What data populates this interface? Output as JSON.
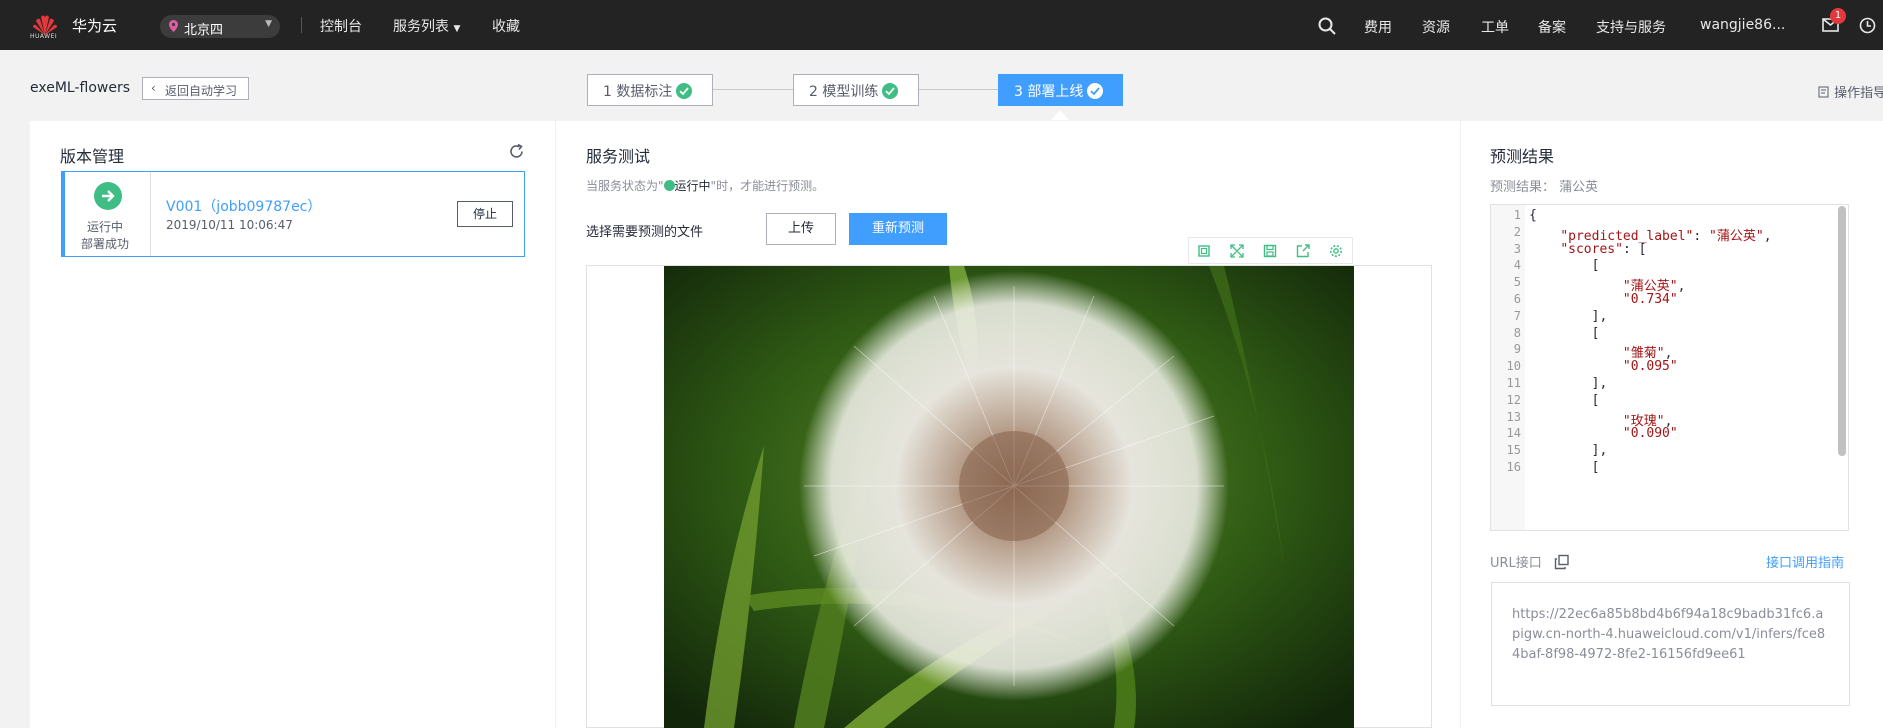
{
  "topbar": {
    "logo_text": "HUAWEI",
    "brand": "华为云",
    "region": "北京四",
    "nav": [
      "控制台",
      "服务列表",
      "收藏"
    ],
    "right_nav": [
      "费用",
      "资源",
      "工单",
      "备案",
      "支持与服务"
    ],
    "user": "wangjie86...",
    "message_count": "1"
  },
  "header": {
    "project": "exeML-flowers",
    "back_label": "返回自动学习",
    "steps": [
      {
        "label": "1 数据标注",
        "done": true
      },
      {
        "label": "2 模型训练",
        "done": true
      },
      {
        "label": "3 部署上线",
        "done": true,
        "active": true
      }
    ],
    "guide": "操作指导"
  },
  "version_panel": {
    "title": "版本管理",
    "card": {
      "status_line1": "运行中",
      "status_line2": "部署成功",
      "name": "V001（jobb09787ec）",
      "date": "2019/10/11 10:06:47",
      "stop_label": "停止"
    }
  },
  "service_panel": {
    "title": "服务测试",
    "hint_prefix": "当服务状态为\"",
    "hint_status": "运行中",
    "hint_suffix": "\"时，才能进行预测。",
    "choose_label": "选择需要预测的文件",
    "upload_label": "上传",
    "repredict_label": "重新预测",
    "toolbar_icons": [
      "copy-icon",
      "fullscreen-icon",
      "save-icon",
      "export-icon",
      "settings-icon"
    ]
  },
  "result_panel": {
    "title": "预测结果",
    "summary": "预测结果：  蒲公英",
    "code_lines": [
      "{",
      "    \"predicted_label\": \"蒲公英\",",
      "    \"scores\": [",
      "        [",
      "            \"蒲公英\",",
      "            \"0.734\"",
      "        ],",
      "        [",
      "            \"雏菊\",",
      "            \"0.095\"",
      "        ],",
      "        [",
      "            \"玫瑰\",",
      "            \"0.090\"",
      "        ],",
      "        ["
    ],
    "url_label": "URL接口",
    "url_guide": "接口调用指南",
    "url": "https://22ec6a85b8bd4b6f94a18c9badb31fc6.apigw.cn-north-4.huaweicloud.com/v1/infers/fce84baf-8f98-4972-8fe2-16156fd9ee61"
  },
  "colors": {
    "accent": "#409eff",
    "success": "#3fbd85",
    "topbar": "#232323"
  }
}
